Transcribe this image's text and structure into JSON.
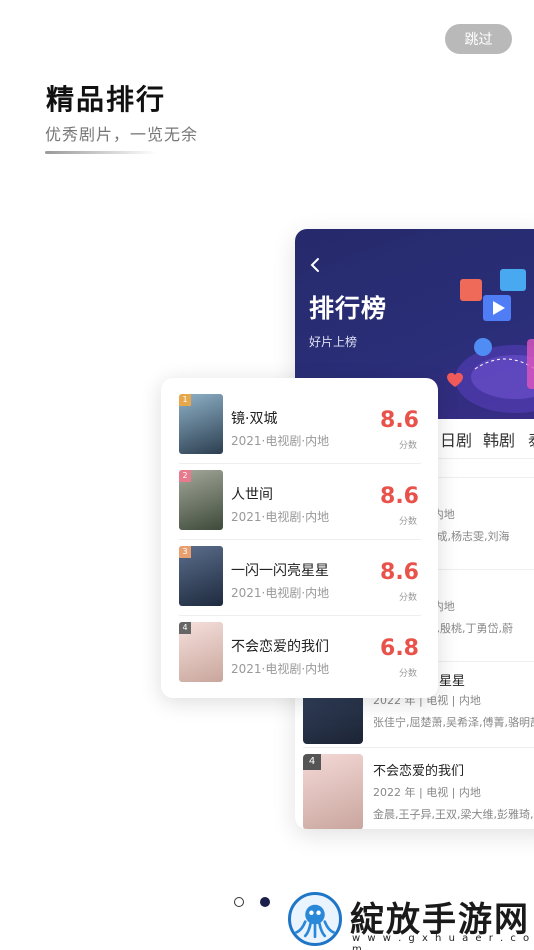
{
  "skip_label": "跳过",
  "intro": {
    "title": "精品排行",
    "subtitle": "优秀剧片，一览无余"
  },
  "back_card": {
    "title": "排行榜",
    "subtitle": "好片上榜",
    "tabs": [
      "日剧",
      "韩剧",
      "泰"
    ],
    "rows": [
      {
        "rank": "",
        "name": "",
        "meta": "视 | 内地",
        "cast": ",郑业成,杨志雯,刘海"
      },
      {
        "rank": "",
        "name": "",
        "meta": "视 | 内地",
        "cast": ",宋佳,殷桃,丁勇岱,蔚"
      },
      {
        "rank": "",
        "name": "星星",
        "meta": "2022 年 | 电视 | 内地",
        "cast": "张佳宁,屈楚萧,吴希泽,傅菁,骆明劼"
      },
      {
        "rank": "4",
        "name": "不会恋爱的我们",
        "meta": "2022 年 | 电视 | 内地",
        "cast": "金晨,王子异,王双,梁大维,彭雅琦,郑"
      }
    ]
  },
  "front_card": {
    "score_label": "分数",
    "rows": [
      {
        "rank": "1",
        "name": "镜·双城",
        "meta": "2021·电视剧·内地",
        "score": "8.6"
      },
      {
        "rank": "2",
        "name": "人世间",
        "meta": "2021·电视剧·内地",
        "score": "8.6"
      },
      {
        "rank": "3",
        "name": "一闪一闪亮星星",
        "meta": "2021·电视剧·内地",
        "score": "8.6"
      },
      {
        "rank": "4",
        "name": "不会恋爱的我们",
        "meta": "2021·电视剧·内地",
        "score": "6.8"
      }
    ]
  },
  "pager": {
    "total": 2,
    "active": 2
  },
  "watermark": {
    "text": "綻放手游网",
    "url": "w w w . g x h u a e r . c o m"
  },
  "colors": {
    "accent_red": "#e8524a",
    "header_blue": "#2a2e78",
    "rank_colors": [
      "#e6a84a",
      "#e87a8e",
      "#e8a070",
      "#666666"
    ]
  }
}
